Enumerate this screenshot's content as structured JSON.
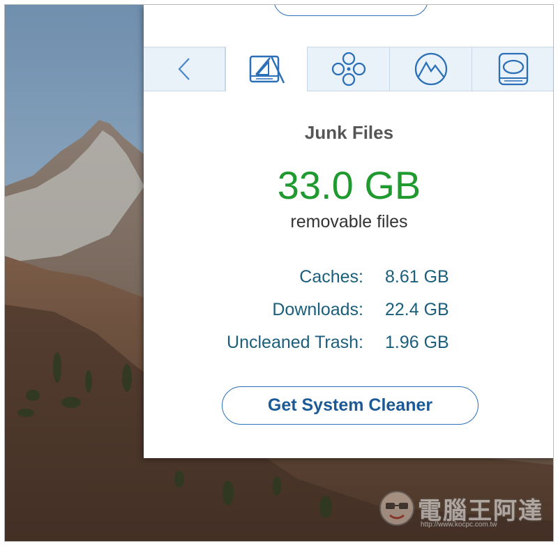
{
  "tabs": [
    {
      "name": "back",
      "icon": "chevron-left-icon",
      "active": false
    },
    {
      "name": "junk-files",
      "icon": "disk-sweep-icon",
      "active": true
    },
    {
      "name": "apps",
      "icon": "flower-circles-icon",
      "active": false
    },
    {
      "name": "photos",
      "icon": "mountain-icon",
      "active": false
    },
    {
      "name": "storage",
      "icon": "hard-drive-icon",
      "active": false
    }
  ],
  "panel": {
    "title": "Junk Files",
    "total_size": "33.0 GB",
    "subtitle": "removable files"
  },
  "stats": [
    {
      "label": "Caches:",
      "value": "8.61 GB"
    },
    {
      "label": "Downloads:",
      "value": "22.4 GB"
    },
    {
      "label": "Uncleaned Trash:",
      "value": "1.96 GB"
    }
  ],
  "cta": {
    "label": "Get System Cleaner"
  },
  "colors": {
    "accent": "#2a6fb8",
    "size_green": "#1f9a2f",
    "stat_text": "#1a5e7c",
    "tab_bg": "#e9f1f9"
  },
  "watermark": {
    "text": "電腦王阿達",
    "url": "http://www.kocpc.com.tw"
  }
}
